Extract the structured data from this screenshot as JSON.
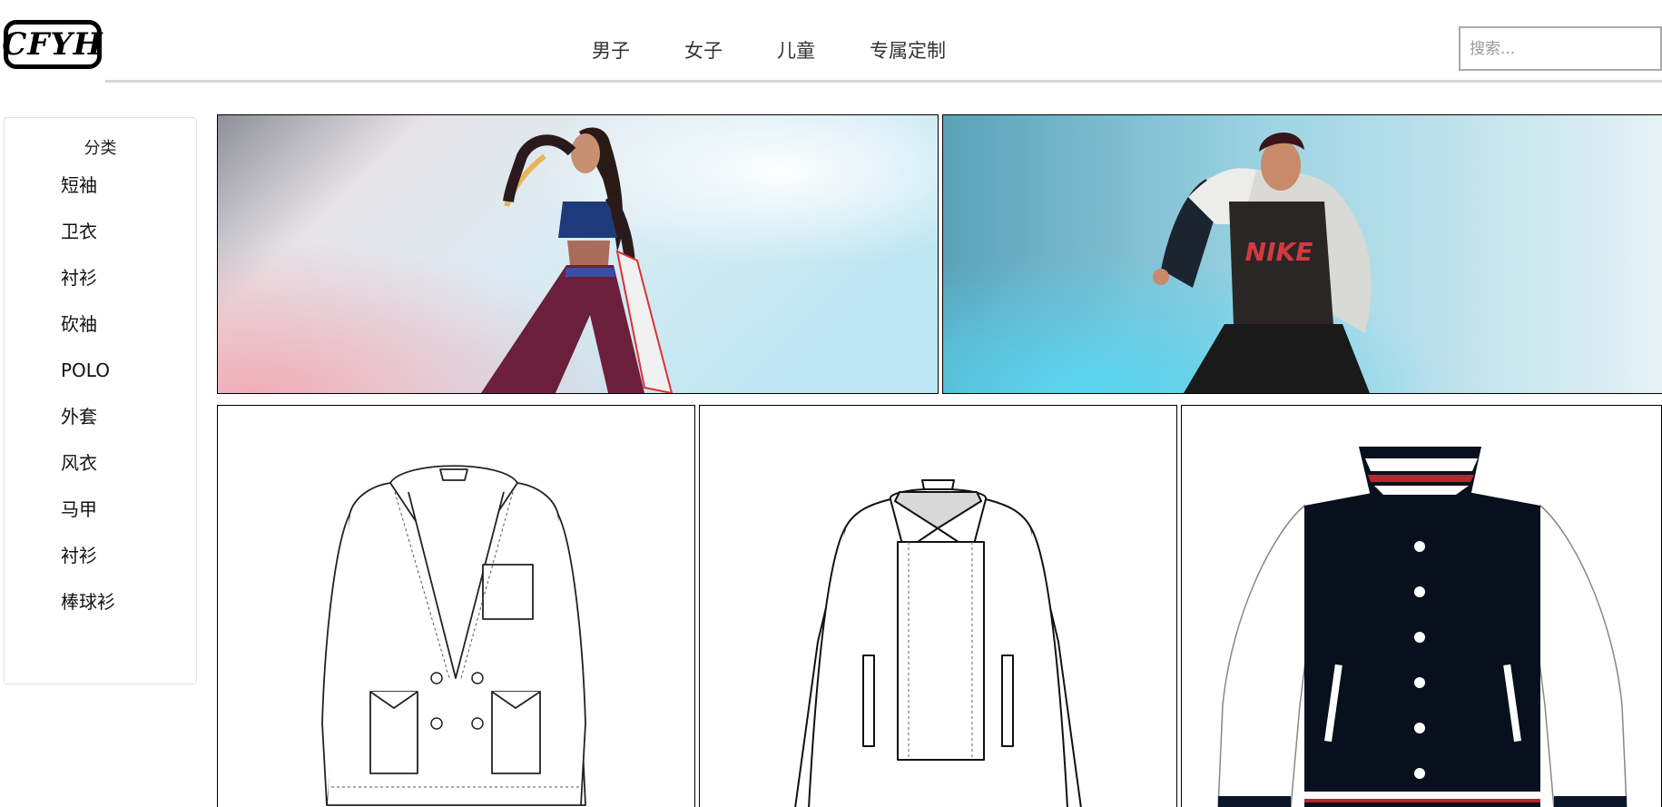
{
  "logo": {
    "text": "CFYH"
  },
  "nav": {
    "items": [
      "男子",
      "女子",
      "儿童",
      "专属定制"
    ]
  },
  "search": {
    "placeholder": "搜索..."
  },
  "sidebar": {
    "title": "分类",
    "items": [
      "短袖",
      "卫衣",
      "衬衫",
      "砍袖",
      "POLO",
      "外套",
      "风衣",
      "马甲",
      "衬衫",
      "棒球衫"
    ]
  },
  "banners": [
    {
      "logo_text": ""
    },
    {
      "logo_text": "NIKE"
    }
  ],
  "colors": {
    "nav_text": "#333333",
    "rule": "#d6d6d6",
    "jacket_navy": "#07101c",
    "stripe_red": "#b8272c"
  }
}
